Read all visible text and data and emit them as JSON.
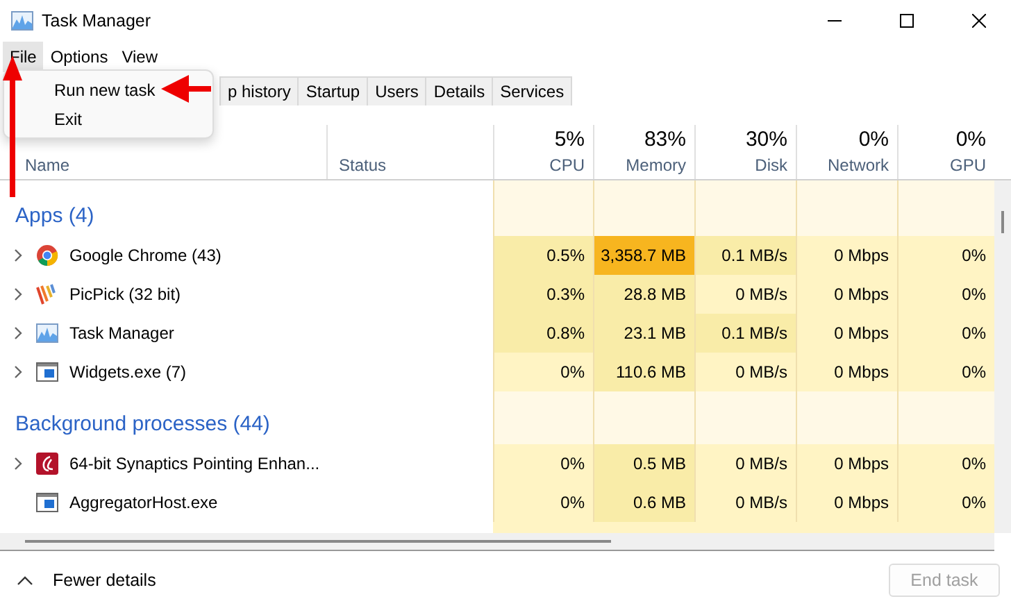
{
  "window": {
    "title": "Task Manager"
  },
  "menu": [
    {
      "label": "File",
      "selected": true
    },
    {
      "label": "Options",
      "selected": false
    },
    {
      "label": "View",
      "selected": false
    }
  ],
  "file_menu": [
    "Run new task",
    "Exit"
  ],
  "tabs": [
    {
      "label": "p history",
      "selected": false
    },
    {
      "label": "Startup",
      "selected": false
    },
    {
      "label": "Users",
      "selected": false
    },
    {
      "label": "Details",
      "selected": false
    },
    {
      "label": "Services",
      "selected": false
    }
  ],
  "columns": [
    {
      "label": "Name"
    },
    {
      "label": "Status"
    },
    {
      "label": "CPU",
      "percent": "5%"
    },
    {
      "label": "Memory",
      "percent": "83%"
    },
    {
      "label": "Disk",
      "percent": "30%"
    },
    {
      "label": "Network",
      "percent": "0%"
    },
    {
      "label": "GPU",
      "percent": "0%"
    }
  ],
  "groups": [
    {
      "title": "Apps (4)",
      "rows": [
        {
          "name": "Google Chrome (43)",
          "expandable": true,
          "cells": [
            {
              "text": "0.5%",
              "color": "#f9eca8"
            },
            {
              "text": "3,358.7 MB",
              "color": "#f7b51f"
            },
            {
              "text": "0.1 MB/s",
              "color": "#f9eca8"
            },
            {
              "text": "0 Mbps",
              "color": "#fff4c4"
            },
            {
              "text": "0%",
              "color": "#fff4c4"
            }
          ]
        },
        {
          "name": "PicPick (32 bit)",
          "expandable": true,
          "cells": [
            {
              "text": "0.3%",
              "color": "#f9eca8"
            },
            {
              "text": "28.8 MB",
              "color": "#f9eca8"
            },
            {
              "text": "0 MB/s",
              "color": "#fff4c4"
            },
            {
              "text": "0 Mbps",
              "color": "#fff4c4"
            },
            {
              "text": "0%",
              "color": "#fff4c4"
            }
          ]
        },
        {
          "name": "Task Manager",
          "expandable": true,
          "cells": [
            {
              "text": "0.8%",
              "color": "#f9eca8"
            },
            {
              "text": "23.1 MB",
              "color": "#f9eca8"
            },
            {
              "text": "0.1 MB/s",
              "color": "#f9eca8"
            },
            {
              "text": "0 Mbps",
              "color": "#fff4c4"
            },
            {
              "text": "0%",
              "color": "#fff4c4"
            }
          ]
        },
        {
          "name": "Widgets.exe (7)",
          "expandable": true,
          "cells": [
            {
              "text": "0%",
              "color": "#fff4c4"
            },
            {
              "text": "110.6 MB",
              "color": "#f9eca8"
            },
            {
              "text": "0 MB/s",
              "color": "#fff4c4"
            },
            {
              "text": "0 Mbps",
              "color": "#fff4c4"
            },
            {
              "text": "0%",
              "color": "#fff4c4"
            }
          ]
        }
      ]
    },
    {
      "title": "Background processes (44)",
      "rows": [
        {
          "name": "64-bit Synaptics Pointing Enhan...",
          "expandable": true,
          "cells": [
            {
              "text": "0%",
              "color": "#fff4c4"
            },
            {
              "text": "0.5 MB",
              "color": "#f9eca8"
            },
            {
              "text": "0 MB/s",
              "color": "#fff4c4"
            },
            {
              "text": "0 Mbps",
              "color": "#fff4c4"
            },
            {
              "text": "0%",
              "color": "#fff4c4"
            }
          ]
        },
        {
          "name": "AggregatorHost.exe",
          "expandable": false,
          "cells": [
            {
              "text": "0%",
              "color": "#fff4c4"
            },
            {
              "text": "0.6 MB",
              "color": "#f9eca8"
            },
            {
              "text": "0 MB/s",
              "color": "#fff4c4"
            },
            {
              "text": "0 Mbps",
              "color": "#fff4c4"
            },
            {
              "text": "0%",
              "color": "#fff4c4"
            }
          ]
        }
      ]
    }
  ],
  "footer": {
    "toggle": "Fewer details",
    "end_task": {
      "label": "End task",
      "disabled": true
    }
  }
}
